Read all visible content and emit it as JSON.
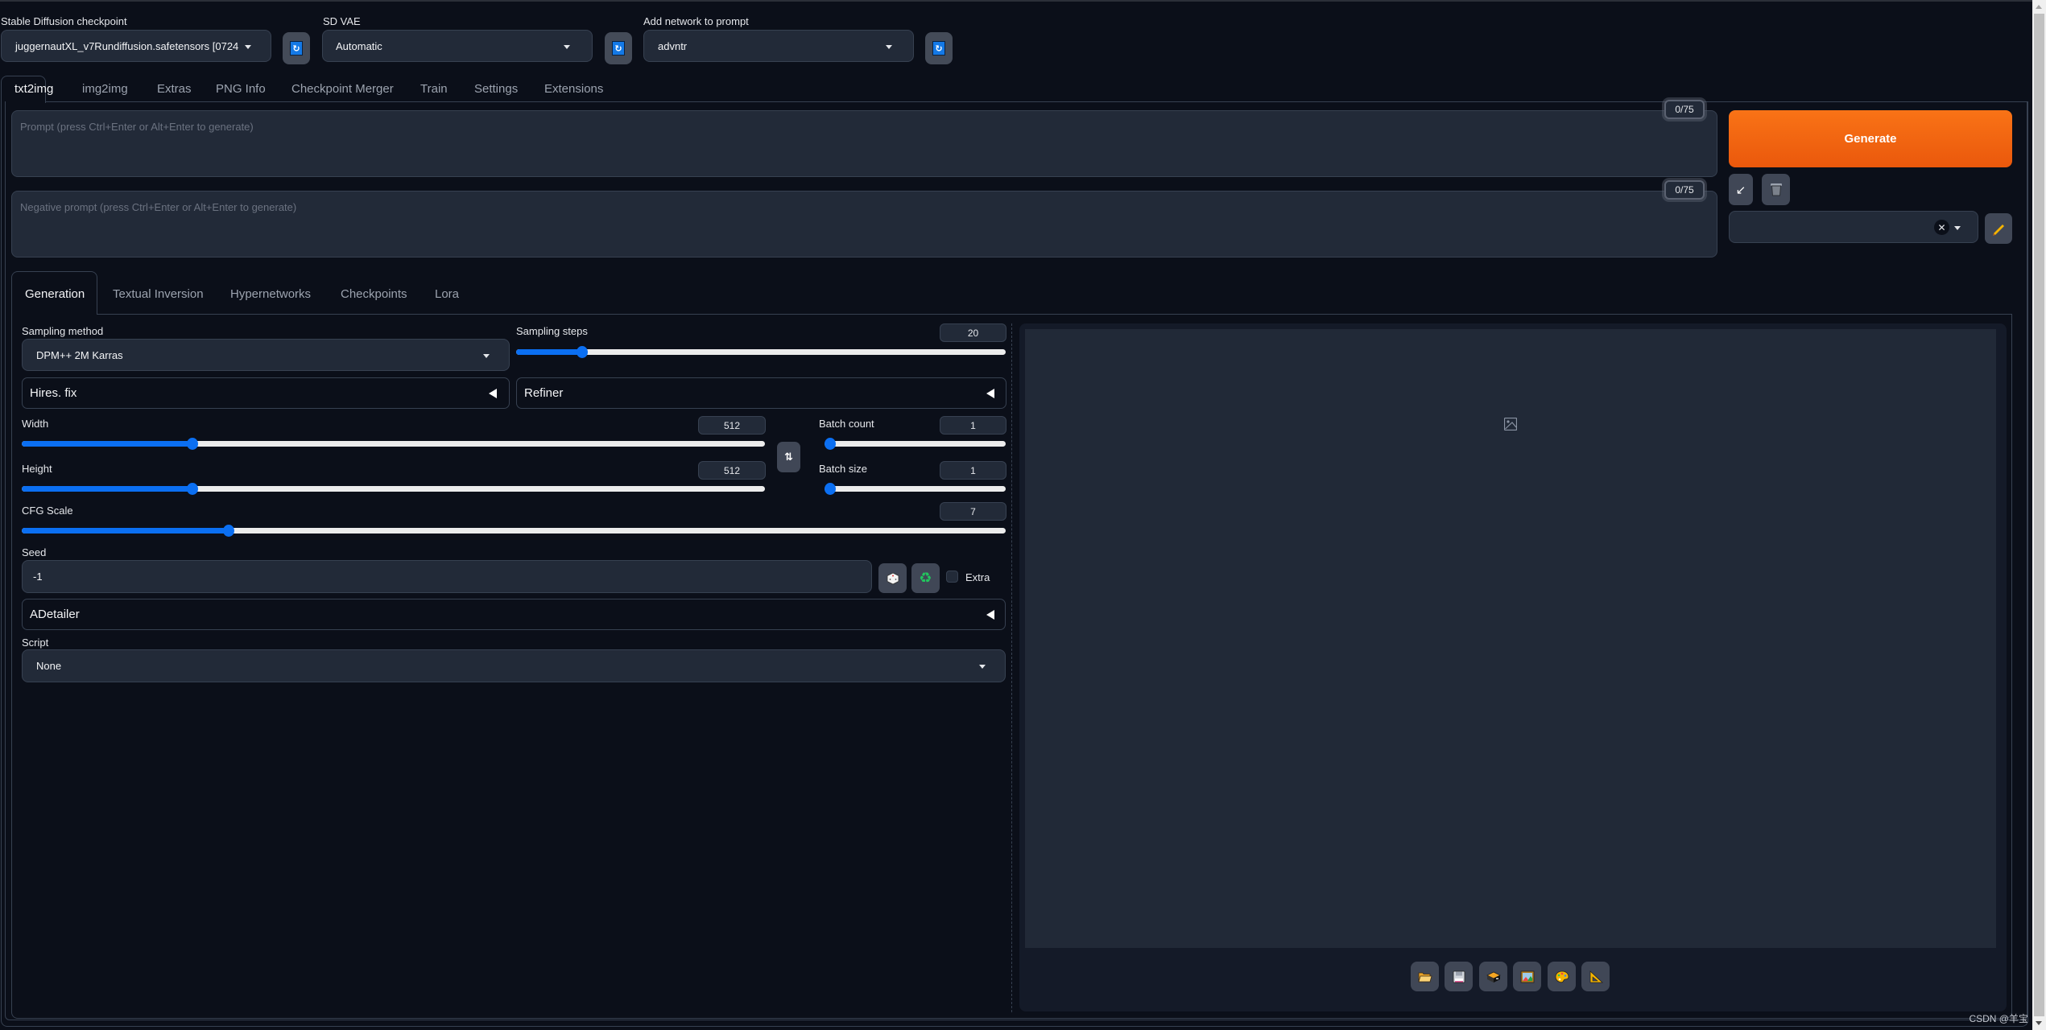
{
  "header": {
    "checkpoint": {
      "label": "Stable Diffusion checkpoint",
      "value": "juggernautXL_v7Rundiffusion.safetensors [0724"
    },
    "vae": {
      "label": "SD VAE",
      "value": "Automatic"
    },
    "network": {
      "label": "Add network to prompt",
      "value": "advntr"
    },
    "refresh_icon": "refresh-icon"
  },
  "main_tabs": [
    {
      "label": "txt2img",
      "active": true
    },
    {
      "label": "img2img"
    },
    {
      "label": "Extras"
    },
    {
      "label": "PNG Info"
    },
    {
      "label": "Checkpoint Merger"
    },
    {
      "label": "Train"
    },
    {
      "label": "Settings"
    },
    {
      "label": "Extensions"
    }
  ],
  "prompt": {
    "placeholder": "Prompt (press Ctrl+Enter or Alt+Enter to generate)",
    "value": "",
    "token_count": "0/75"
  },
  "negative_prompt": {
    "placeholder": "Negative prompt (press Ctrl+Enter or Alt+Enter to generate)",
    "value": "",
    "token_count": "0/75"
  },
  "actions": {
    "generate_label": "Generate",
    "read_params_icon": "arrow-down-left-icon",
    "clear_icon": "trash-icon",
    "styles_value": "",
    "edit_styles_icon": "pencil-icon"
  },
  "sub_tabs": [
    {
      "label": "Generation",
      "active": true
    },
    {
      "label": "Textual Inversion"
    },
    {
      "label": "Hypernetworks"
    },
    {
      "label": "Checkpoints"
    },
    {
      "label": "Lora"
    }
  ],
  "generation": {
    "sampling_method": {
      "label": "Sampling method",
      "value": "DPM++ 2M Karras"
    },
    "sampling_steps": {
      "label": "Sampling steps",
      "value": "20",
      "fraction": 0.135
    },
    "hires_fix": {
      "label": "Hires. fix"
    },
    "refiner": {
      "label": "Refiner"
    },
    "width": {
      "label": "Width",
      "value": "512",
      "fraction": 0.23
    },
    "height": {
      "label": "Height",
      "value": "512",
      "fraction": 0.23
    },
    "swap_icon": "swap-vertical-icon",
    "batch_count": {
      "label": "Batch count",
      "value": "1",
      "fraction": 0.0
    },
    "batch_size": {
      "label": "Batch size",
      "value": "1",
      "fraction": 0.0
    },
    "cfg_scale": {
      "label": "CFG Scale",
      "value": "7",
      "fraction": 0.21
    },
    "seed": {
      "label": "Seed",
      "value": "-1",
      "random_icon": "dice-icon",
      "reuse_icon": "recycle-icon",
      "extra_label": "Extra",
      "extra_checked": false
    },
    "adetailer": {
      "label": "ADetailer"
    },
    "script": {
      "label": "Script",
      "value": "None"
    }
  },
  "output": {
    "placeholder_icon": "image-icon",
    "buttons": [
      {
        "name": "open-folder",
        "icon": "folder-icon"
      },
      {
        "name": "save",
        "icon": "floppy-disk-icon"
      },
      {
        "name": "zip",
        "icon": "archive-box-icon"
      },
      {
        "name": "send-to-img2img",
        "icon": "framed-picture-icon"
      },
      {
        "name": "send-to-inpaint",
        "icon": "palette-icon"
      },
      {
        "name": "send-to-extras",
        "icon": "triangle-ruler-icon"
      }
    ]
  },
  "watermark": "CSDN @羊宝"
}
